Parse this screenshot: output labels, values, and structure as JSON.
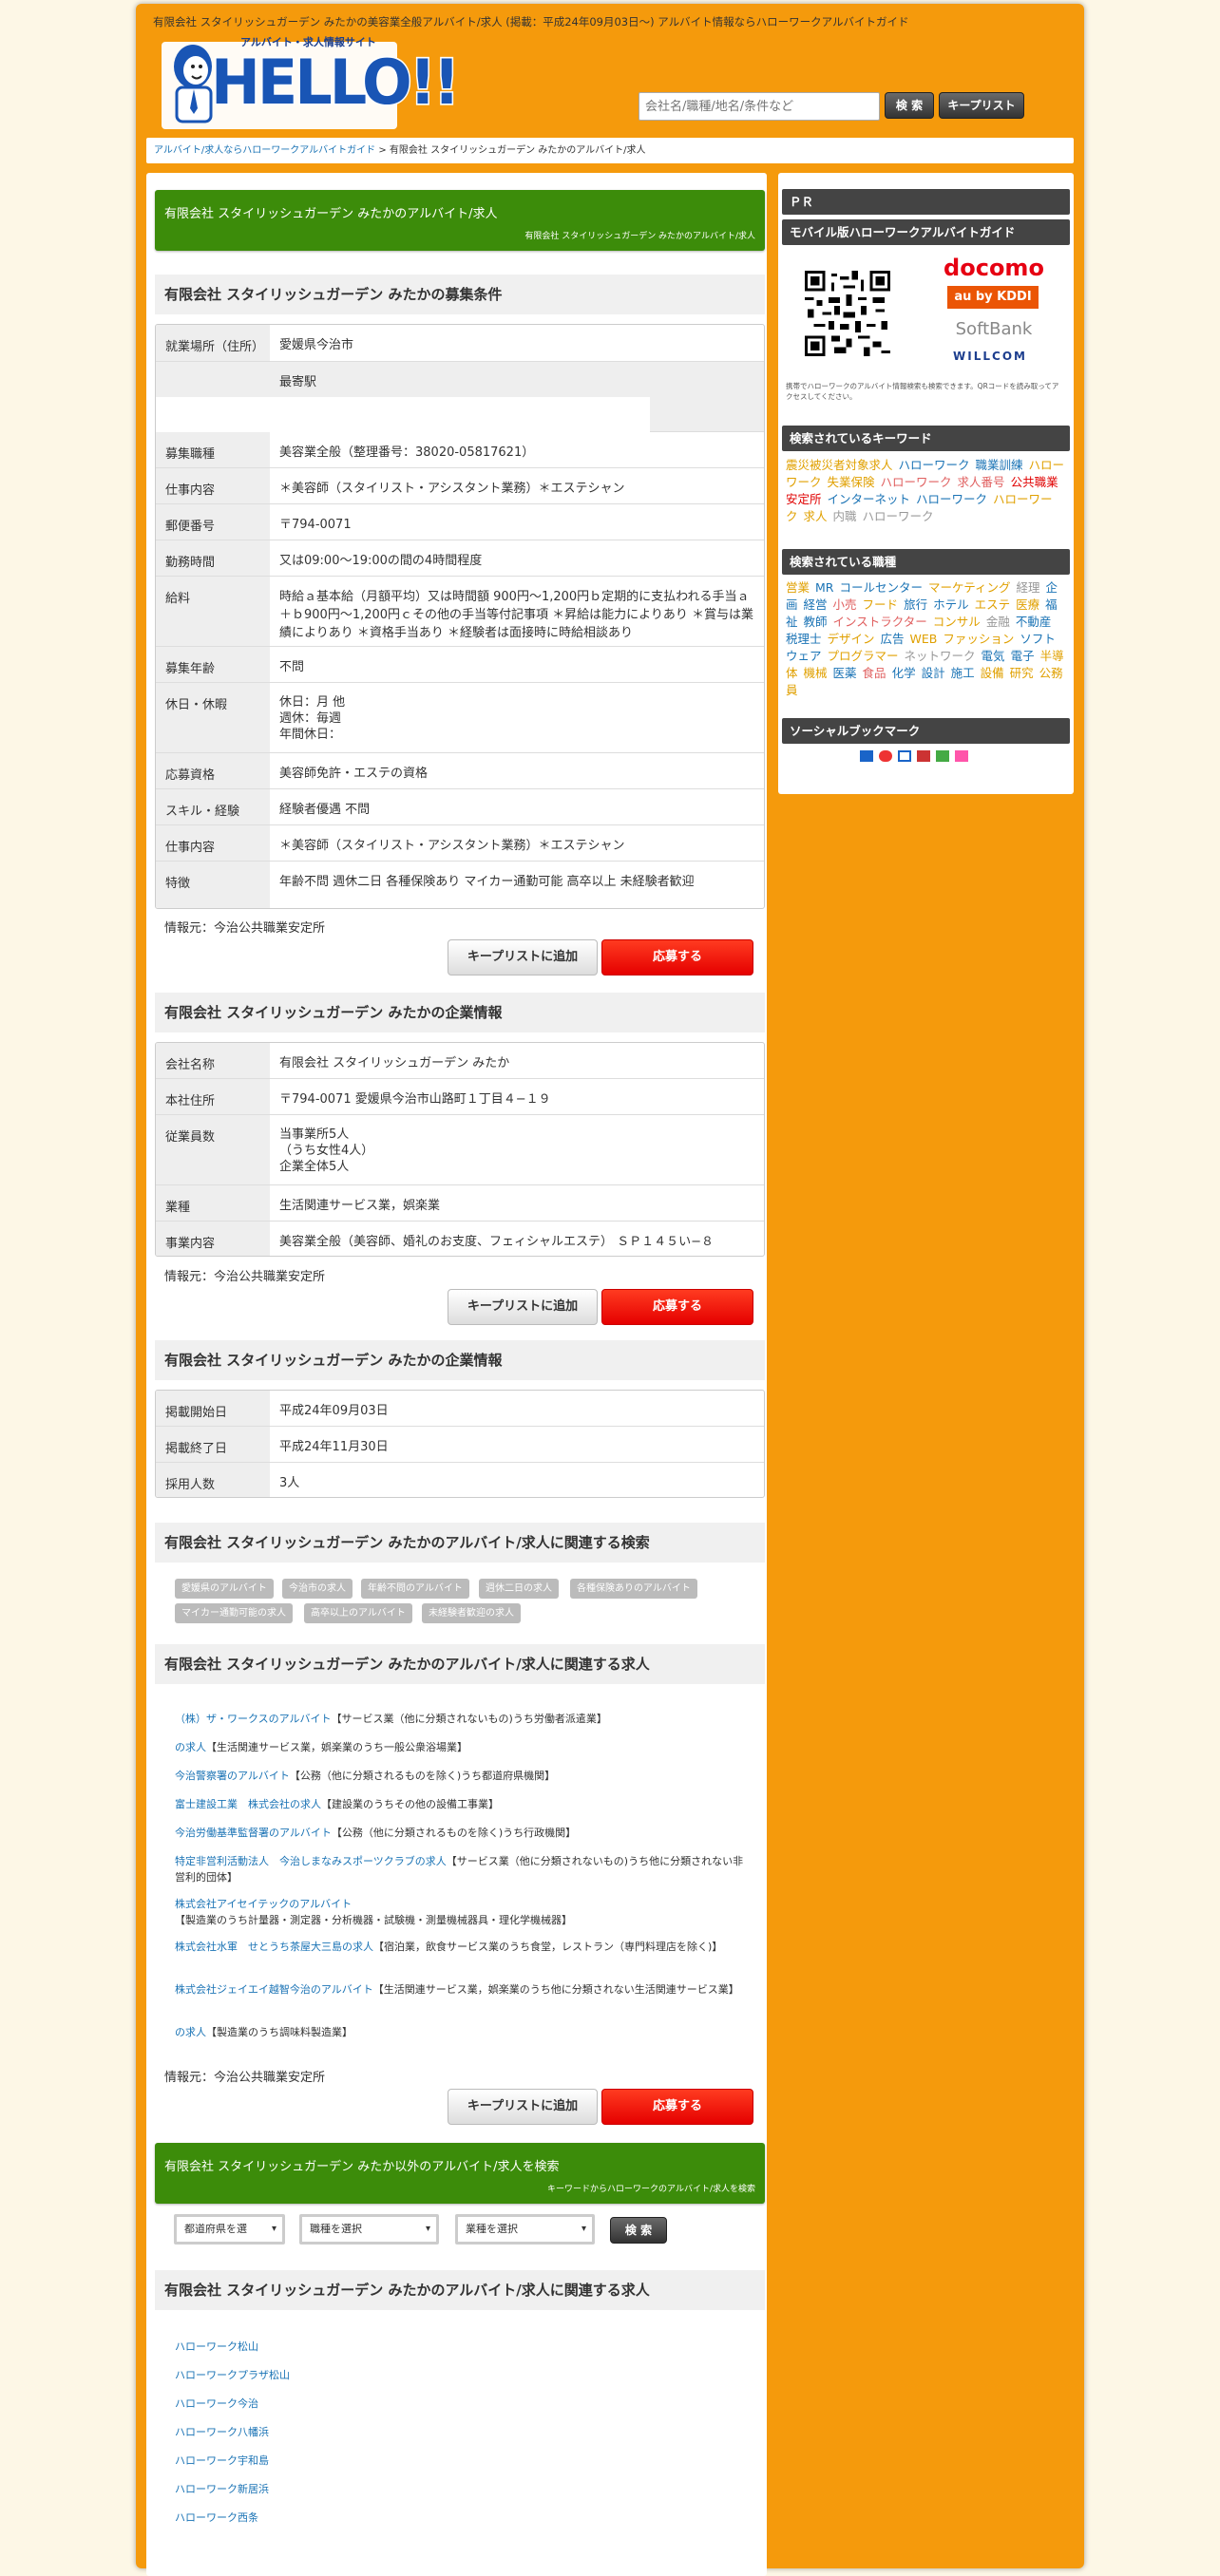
{
  "header": {
    "top_text": "有限会社 スタイリッシュガーデン みたかの美容業全般アルバイト/求人 (掲載：平成24年09月03日～) アルバイト情報ならハローワークアルバイトガイド",
    "logo_tagline": "アルバイト・求人情報サイト",
    "logo_text": "HELLO!!",
    "search_placeholder": "会社名/職種/地名/条件など",
    "search_btn": "検 索",
    "keeplist_btn": "キープリスト"
  },
  "breadcrumb": {
    "link": "アルバイト/求人ならハローワークアルバイトガイド",
    "sep": " > ",
    "current": "有限会社 スタイリッシュガーデン みたかのアルバイト/求人"
  },
  "title_box": {
    "title": "有限会社 スタイリッシュガーデン みたかのアルバイト/求人",
    "sub": "有限会社 スタイリッシュガーデン みたかのアルバイト/求人"
  },
  "cond": {
    "heading": "有限会社 スタイリッシュガーデン みたかの募集条件",
    "rows": [
      {
        "k": "就業場所（住所）",
        "v": "愛媛県今治市"
      },
      {
        "k": "",
        "v": "最寄駅"
      },
      {
        "k": "募集職種",
        "v": "美容業全般（整理番号：38020-05817621）"
      },
      {
        "k": "仕事内容",
        "v": "＊美容師（スタイリスト・アシスタント業務）＊エステシャン"
      },
      {
        "k": "郵便番号",
        "v": "〒794-0071"
      },
      {
        "k": "勤務時間",
        "v": "又は09:00〜19:00の間の4時間程度"
      },
      {
        "k": "給料",
        "v": "時給ａ基本給（月額平均）又は時間額 900円〜1,200円ｂ定期的に支払われる手当ａ＋ｂ900円〜1,200円ｃその他の手当等付記事項 ＊昇給は能力によりあり ＊賞与は業績によりあり ＊資格手当あり ＊経験者は面接時に時給相談あり"
      },
      {
        "k": "募集年齢",
        "v": "不問"
      },
      {
        "k": "休日・休暇",
        "v": "休日：月 他\n週休：毎週\n年間休日："
      },
      {
        "k": "応募資格",
        "v": "美容師免許・エステの資格"
      },
      {
        "k": "スキル・経験",
        "v": "経験者優遇 不問"
      },
      {
        "k": "仕事内容",
        "v": "＊美容師（スタイリスト・アシスタント業務）＊エステシャン"
      },
      {
        "k": "特徴",
        "v": "年齢不問 週休二日 各種保険あり マイカー通勤可能 高卒以上 未経験者歓迎"
      }
    ]
  },
  "source_label": "情報元：今治公共職業安定所",
  "keep_btn": "キープリストに追加",
  "apply_btn": "応募する",
  "company": {
    "heading": "有限会社 スタイリッシュガーデン みたかの企業情報",
    "rows": [
      {
        "k": "会社名称",
        "v": "有限会社 スタイリッシュガーデン みたか"
      },
      {
        "k": "本社住所",
        "v": "〒794-0071 愛媛県今治市山路町１丁目４−１９"
      },
      {
        "k": "従業員数",
        "v": "当事業所5人\n（うち女性4人）\n企業全体5人"
      },
      {
        "k": "業種",
        "v": "生活関連サービス業，娯楽業"
      },
      {
        "k": "事業内容",
        "v": "美容業全般（美容師、婚礼のお支度、フェィシャルエステ） ＳＰ１４５い−８"
      }
    ]
  },
  "posting": {
    "heading": "有限会社 スタイリッシュガーデン みたかの企業情報",
    "rows": [
      {
        "k": "掲載開始日",
        "v": "平成24年09月03日"
      },
      {
        "k": "掲載終了日",
        "v": "平成24年11月30日"
      },
      {
        "k": "採用人数",
        "v": "3人"
      }
    ]
  },
  "related_search": {
    "heading": "有限会社 スタイリッシュガーデン みたかのアルバイト/求人に関連する検索",
    "chips": [
      "愛媛県のアルバイト",
      "今治市の求人",
      "年齢不問のアルバイト",
      "週休二日の求人",
      "各種保険ありのアルバイト",
      "マイカー通勤可能の求人",
      "高卒以上のアルバイト",
      "未経験者歓迎の求人"
    ]
  },
  "related_jobs": {
    "heading": "有限会社 スタイリッシュガーデン みたかのアルバイト/求人に関連する求人",
    "items": [
      {
        "link": "（株）ザ・ワークスのアルバイト",
        "desc": "【サービス業（他に分類されないもの)うち労働者派遣業】"
      },
      {
        "link": "の求人",
        "desc": "【生活関連サービス業，娯楽業のうち一般公衆浴場業】"
      },
      {
        "link": "今治警察署のアルバイト",
        "desc": "【公務（他に分類されるものを除く)うち都道府県機関】"
      },
      {
        "link": "富士建設工業　株式会社の求人",
        "desc": "【建設業のうちその他の設備工事業】"
      },
      {
        "link": "今治労働基準監督署のアルバイト",
        "desc": "【公務（他に分類されるものを除く)うち行政機関】"
      },
      {
        "link": "特定非営利活動法人　今治しまなみスポーツクラブの求人",
        "desc": "【サービス業（他に分類されないもの)うち他に分類されない非営利的団体】"
      },
      {
        "link": "株式会社アイセイテックのアルバイト",
        "desc": "【製造業のうち計量器・測定器・分析機器・試験機・測量機械器具・理化学機械器】"
      },
      {
        "link": "株式会社水軍　せとうち茶屋大三島の求人",
        "desc": "【宿泊業，飲食サービス業のうち食堂，レストラン（専門料理店を除く)】"
      },
      {
        "link": "株式会社ジェイエイ越智今治のアルバイト",
        "desc": "【生活関連サービス業，娯楽業のうち他に分類されない生活関連サービス業】"
      },
      {
        "link": "の求人",
        "desc": "【製造業のうち調味料製造業】"
      }
    ]
  },
  "other_search": {
    "title": "有限会社 スタイリッシュガーデン みたか以外のアルバイト/求人を検索",
    "sub": "キーワードからハローワークのアルバイト/求人を検索",
    "pref": "都道府県を選",
    "job": "職種を選択",
    "ind": "業種を選択",
    "btn": "検 索"
  },
  "hellowork": {
    "heading": "有限会社 スタイリッシュガーデン みたかのアルバイト/求人に関連する求人",
    "items": [
      "ハローワーク松山",
      "ハローワークプラザ松山",
      "ハローワーク今治",
      "ハローワーク八幡浜",
      "ハローワーク宇和島",
      "ハローワーク新居浜",
      "ハローワーク西条"
    ]
  },
  "sidebar": {
    "pr": "ＰＲ",
    "mobile": "モバイル版ハローワークアルバイトガイド",
    "mobile_note": "携帯でハローワークのアルバイト情報検索も検索できます。QRコードを読み取ってアクセスしてください。",
    "carriers": [
      "docomo",
      "au by KDDI",
      "SoftBank",
      "WILLCOM"
    ],
    "kw_title": "検索されているキーワード",
    "keywords": [
      {
        "t": "震災被災者対象求人",
        "c": "#e0a000"
      },
      {
        "t": "ハローワーク",
        "c": "#1a73b5"
      },
      {
        "t": "職業訓練",
        "c": "#1a73b5"
      },
      {
        "t": "ハローワーク",
        "c": "#e0a000"
      },
      {
        "t": "失業保険",
        "c": "#e0a000"
      },
      {
        "t": "ハローワーク",
        "c": "#e06060"
      },
      {
        "t": "求人番号",
        "c": "#e06060"
      },
      {
        "t": "公共職業安定所",
        "c": "#e00000"
      },
      {
        "t": "インターネット",
        "c": "#1a73b5"
      },
      {
        "t": "ハローワーク",
        "c": "#1a73b5"
      },
      {
        "t": "ハローワーク",
        "c": "#e0a000"
      },
      {
        "t": "求人",
        "c": "#e0a000"
      },
      {
        "t": "内職",
        "c": "#999"
      },
      {
        "t": "ハローワーク",
        "c": "#999"
      }
    ],
    "job_title": "検索されている職種",
    "jobs": [
      {
        "t": "営業",
        "c": "#e0a000"
      },
      {
        "t": "MR",
        "c": "#1a73b5"
      },
      {
        "t": "コールセンター",
        "c": "#1a73b5"
      },
      {
        "t": "マーケティング",
        "c": "#e0a000"
      },
      {
        "t": "経理",
        "c": "#999"
      },
      {
        "t": "企画",
        "c": "#1a73b5"
      },
      {
        "t": "経営",
        "c": "#1a73b5"
      },
      {
        "t": "小売",
        "c": "#e06060"
      },
      {
        "t": "フード",
        "c": "#e0a000"
      },
      {
        "t": "旅行",
        "c": "#1a73b5"
      },
      {
        "t": "ホテル",
        "c": "#1a73b5"
      },
      {
        "t": "エステ",
        "c": "#e0a000"
      },
      {
        "t": "医療",
        "c": "#e0a000"
      },
      {
        "t": "福祉",
        "c": "#1a73b5"
      },
      {
        "t": "教師",
        "c": "#1a73b5"
      },
      {
        "t": "インストラクター",
        "c": "#e06060"
      },
      {
        "t": "コンサル",
        "c": "#e0a000"
      },
      {
        "t": "金融",
        "c": "#999"
      },
      {
        "t": "不動産",
        "c": "#1a73b5"
      },
      {
        "t": "税理士",
        "c": "#1a73b5"
      },
      {
        "t": "デザイン",
        "c": "#e0a000"
      },
      {
        "t": "広告",
        "c": "#1a73b5"
      },
      {
        "t": "WEB",
        "c": "#e0a000"
      },
      {
        "t": "ファッション",
        "c": "#e0a000"
      },
      {
        "t": "ソフトウェア",
        "c": "#1a73b5"
      },
      {
        "t": "プログラマー",
        "c": "#e0a000"
      },
      {
        "t": "ネットワーク",
        "c": "#999"
      },
      {
        "t": "電気",
        "c": "#1a73b5"
      },
      {
        "t": "電子",
        "c": "#1a73b5"
      },
      {
        "t": "半導体",
        "c": "#e0a000"
      },
      {
        "t": "機械",
        "c": "#e0a000"
      },
      {
        "t": "医薬",
        "c": "#1a73b5"
      },
      {
        "t": "食品",
        "c": "#e06060"
      },
      {
        "t": "化学",
        "c": "#1a73b5"
      },
      {
        "t": "設計",
        "c": "#1a73b5"
      },
      {
        "t": "施工",
        "c": "#1a73b5"
      },
      {
        "t": "設備",
        "c": "#e0a000"
      },
      {
        "t": "研究",
        "c": "#e0a000"
      },
      {
        "t": "公務員",
        "c": "#e0a000"
      }
    ],
    "social_title": "ソーシャルブックマーク"
  }
}
